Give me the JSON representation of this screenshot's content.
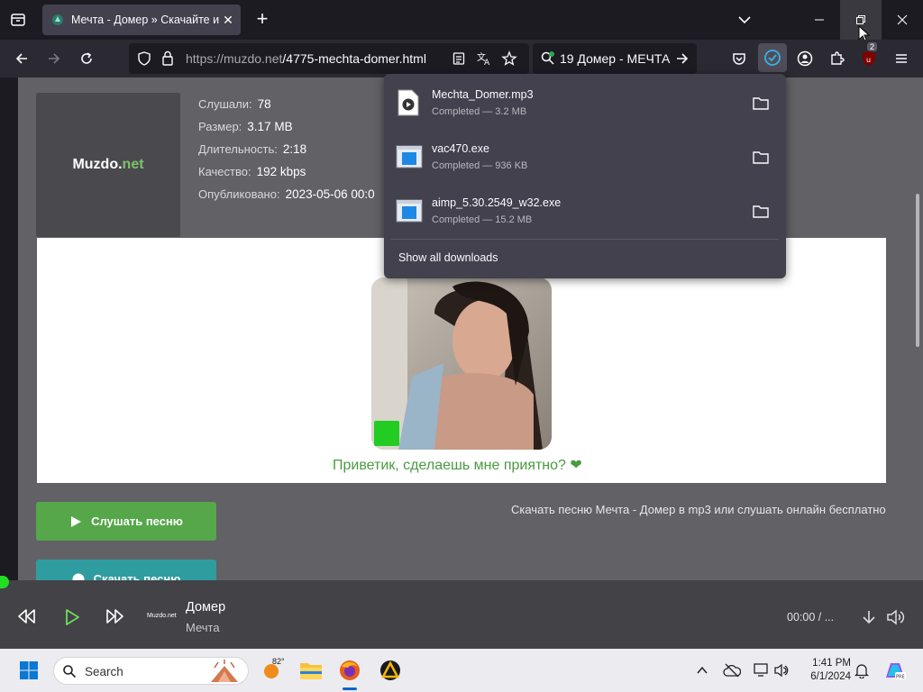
{
  "browser": {
    "tab": {
      "title": "Мечта - Домер » Скачайте и с"
    },
    "url": {
      "host": "https://muzdo.net",
      "path": "/4775-mechta-domer.html"
    },
    "search": {
      "text": "19 Домер - МЕЧТА"
    },
    "extension_badge": "2"
  },
  "page": {
    "logo": {
      "main": "Muzdo.",
      "accent": "net"
    },
    "meta": [
      {
        "label": "Слушали:",
        "value": "78"
      },
      {
        "label": "Размер:",
        "value": "3.17 MB"
      },
      {
        "label": "Длительность:",
        "value": "2:18"
      },
      {
        "label": "Качество:",
        "value": "192 kbps"
      },
      {
        "label": "Опубликовано:",
        "value": "2023-05-06 00:0"
      }
    ],
    "promo_text": "Приветик, сделаешь мне приятно? ❤",
    "listen_button": "Слушать песню",
    "download_button": "Скачать песню",
    "caption": "Скачать песню Мечта - Домер в mp3 или слушать онлайн бесплатно"
  },
  "downloads_panel": {
    "items": [
      {
        "name": "Mechta_Domer.mp3",
        "status": "Completed — 3.2 MB",
        "icon": "audio-file-icon"
      },
      {
        "name": "vac470.exe",
        "status": "Completed — 936 KB",
        "icon": "exe-file-icon"
      },
      {
        "name": "aimp_5.30.2549_w32.exe",
        "status": "Completed — 15.2 MB",
        "icon": "exe-file-icon"
      }
    ],
    "show_all": "Show all downloads"
  },
  "player": {
    "title": "Домер",
    "artist": "Мечта",
    "time": "00:00  /  ...",
    "logo": "Muzdo.net"
  },
  "taskbar": {
    "search_placeholder": "Search",
    "weather_temp": "82°",
    "time": "1:41 PM",
    "date": "6/1/2024"
  },
  "colors": {
    "accent_green": "#55a74a",
    "accent_teal": "#2f9da0",
    "promo_green": "#4a9a40"
  }
}
